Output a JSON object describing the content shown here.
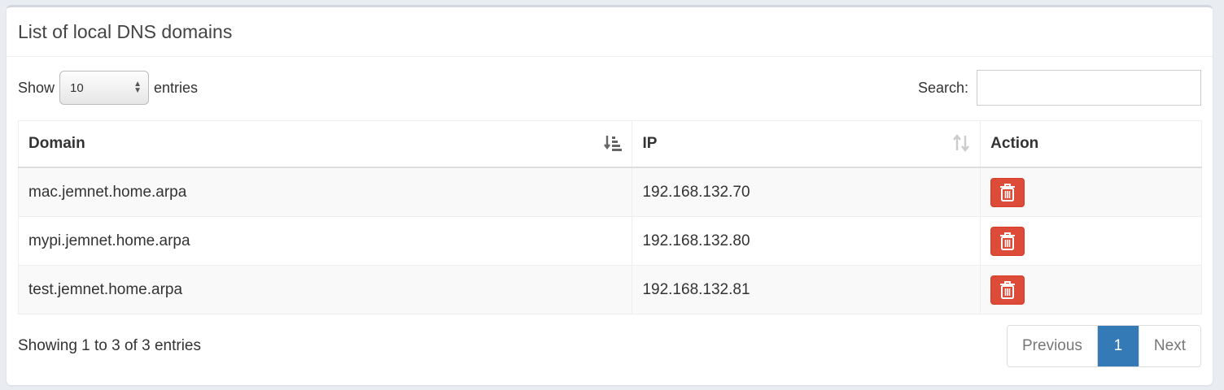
{
  "box": {
    "title": "List of local DNS domains"
  },
  "length": {
    "show_label": "Show",
    "value": "10",
    "entries_label": "entries"
  },
  "search": {
    "label": "Search:",
    "value": "",
    "placeholder": ""
  },
  "table": {
    "columns": [
      {
        "label": "Domain",
        "sort_icon": "sort-amount-asc-icon"
      },
      {
        "label": "IP",
        "sort_icon": "sort-icon"
      },
      {
        "label": "Action"
      }
    ],
    "rows": [
      {
        "domain": "mac.jemnet.home.arpa",
        "ip": "192.168.132.70"
      },
      {
        "domain": "mypi.jemnet.home.arpa",
        "ip": "192.168.132.80"
      },
      {
        "domain": "test.jemnet.home.arpa",
        "ip": "192.168.132.81"
      }
    ],
    "action_icon": "trash-icon"
  },
  "info": "Showing 1 to 3 of 3 entries",
  "pagination": {
    "previous": "Previous",
    "current": "1",
    "next": "Next"
  },
  "colors": {
    "danger": "#dd4b39",
    "primary": "#337ab7"
  }
}
